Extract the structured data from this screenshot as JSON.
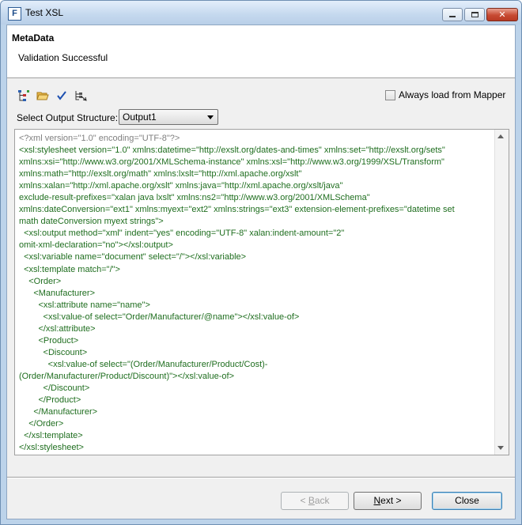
{
  "window": {
    "title": "Test XSL"
  },
  "header": {
    "title": "MetaData",
    "message": "Validation Successful"
  },
  "toolbar": {
    "icons": [
      "tree-view-icon",
      "open-folder-icon",
      "validate-check-icon",
      "schema-select-icon"
    ],
    "always_load_label": "Always load from Mapper",
    "always_load_checked": false
  },
  "output_structure": {
    "label": "Select Output Structure:",
    "value": "Output1"
  },
  "editor": {
    "lines": [
      [
        {
          "t": "<?xml version=\"1.0\" encoding=\"UTF-8\"?>",
          "c": "#808080"
        }
      ],
      [
        {
          "t": "<xsl:stylesheet version=\"1.0\" xmlns:datetime=\"http://exslt.org/dates-and-times\" xmlns:set=\"http://exslt.org/sets\"",
          "c": "#1f6e1f"
        }
      ],
      [
        {
          "t": "xmlns:xsi=\"http://www.w3.org/2001/XMLSchema-instance\" xmlns:xsl=\"http://www.w3.org/1999/XSL/Transform\"",
          "c": "#1f6e1f"
        }
      ],
      [
        {
          "t": "xmlns:math=\"http://exslt.org/math\" xmlns:lxslt=\"http://xml.apache.org/xslt\"",
          "c": "#1f6e1f"
        }
      ],
      [
        {
          "t": "xmlns:xalan=\"http://xml.apache.org/xslt\" xmlns:java=\"http://xml.apache.org/xslt/java\"",
          "c": "#1f6e1f"
        }
      ],
      [
        {
          "t": "exclude-result-prefixes=\"xalan java lxslt\" xmlns:ns2=\"http://www.w3.org/2001/XMLSchema\"",
          "c": "#1f6e1f"
        }
      ],
      [
        {
          "t": "xmlns:dateConversion=\"ext1\" xmlns:myext=\"ext2\" xmlns:strings=\"ext3\" extension-element-prefixes=\"datetime set",
          "c": "#1f6e1f"
        }
      ],
      [
        {
          "t": "math dateConversion myext strings\">",
          "c": "#1f6e1f"
        }
      ],
      [
        {
          "t": "  <xsl:output method=\"xml\" indent=\"yes\" encoding=\"UTF-8\" xalan:indent-amount=\"2\"",
          "c": "#1f6e1f"
        }
      ],
      [
        {
          "t": "omit-xml-declaration=\"no\"></xsl:output>",
          "c": "#1f6e1f"
        }
      ],
      [
        {
          "t": "  <xsl:variable name=\"document\" select=\"/\"></xsl:variable>",
          "c": "#1f6e1f"
        }
      ],
      [
        {
          "t": "  <xsl:template match=\"/\">",
          "c": "#1f6e1f"
        }
      ],
      [
        {
          "t": "    <Order>",
          "c": "#1f6e1f"
        }
      ],
      [
        {
          "t": "      <Manufacturer>",
          "c": "#1f6e1f"
        }
      ],
      [
        {
          "t": "        <xsl:attribute name=\"name\">",
          "c": "#1f6e1f"
        }
      ],
      [
        {
          "t": "          <xsl:value-of select=\"Order/Manufacturer/@name\"></xsl:value-of>",
          "c": "#1f6e1f"
        }
      ],
      [
        {
          "t": "        </xsl:attribute>",
          "c": "#1f6e1f"
        }
      ],
      [
        {
          "t": "        <Product>",
          "c": "#1f6e1f"
        }
      ],
      [
        {
          "t": "          <Discount>",
          "c": "#1f6e1f"
        }
      ],
      [
        {
          "t": "            <xsl:value-of select=\"(Order/Manufacturer/Product/Cost)-",
          "c": "#1f6e1f"
        }
      ],
      [
        {
          "t": "(Order/Manufacturer/Product/Discount)\"></xsl:value-of>",
          "c": "#1f6e1f"
        }
      ],
      [
        {
          "t": "          </Discount>",
          "c": "#1f6e1f"
        }
      ],
      [
        {
          "t": "        </Product>",
          "c": "#1f6e1f"
        }
      ],
      [
        {
          "t": "      </Manufacturer>",
          "c": "#1f6e1f"
        }
      ],
      [
        {
          "t": "    </Order>",
          "c": "#1f6e1f"
        }
      ],
      [
        {
          "t": "  </xsl:template>",
          "c": "#1f6e1f"
        }
      ],
      [
        {
          "t": "</xsl:stylesheet>",
          "c": "#1f6e1f"
        }
      ]
    ]
  },
  "buttons": {
    "back": {
      "prefix": "< ",
      "mnemonic": "B",
      "rest": "ack"
    },
    "next": {
      "mnemonic": "N",
      "rest": "ext >"
    },
    "close": "Close"
  },
  "colors": {
    "tag": "#1f6e1f",
    "declaration": "#808080",
    "accent": "#3c7fb1"
  }
}
